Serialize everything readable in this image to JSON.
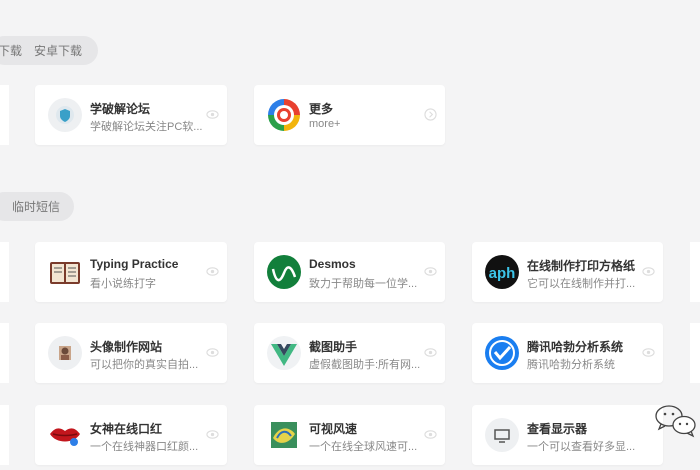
{
  "tabs_top": {
    "item1": "下载",
    "item2": "安卓下载"
  },
  "tabs_mid": {
    "item1": "临时短信"
  },
  "cards": [
    {
      "title": "学破解论坛",
      "desc": "学破解论坛关注PC软..."
    },
    {
      "title": "更多",
      "desc": "more+"
    },
    {
      "title": "Typing Practice",
      "desc": "看小说练打字"
    },
    {
      "title": "Desmos",
      "desc": "致力于帮助每一位学..."
    },
    {
      "title": "在线制作打印方格纸",
      "desc": "它可以在线制作并打..."
    },
    {
      "title": "头像制作网站",
      "desc": "可以把你的真实自拍..."
    },
    {
      "title": "截图助手",
      "desc": "虚假截图助手:所有网..."
    },
    {
      "title": "腾讯哈勃分析系统",
      "desc": "腾讯哈勃分析系统"
    },
    {
      "title": "女神在线口红",
      "desc": "一个在线神器口红颜..."
    },
    {
      "title": "可视风速",
      "desc": "一个在线全球风速可..."
    },
    {
      "title": "查看显示器",
      "desc": "一个可以查看好多显..."
    }
  ],
  "icons": {
    "xuepojie": "shield-icon",
    "more": "color-wheel-icon",
    "typing": "book-icon",
    "desmos": "graph-icon",
    "aph": "aph-logo",
    "avatar": "portrait-icon",
    "screenshot": "vue-logo",
    "habo": "check-shield-icon",
    "lipstick": "lips-icon",
    "wind": "globe-icon",
    "monitor": "monitor-icon"
  },
  "colors": {
    "desmos": "#127f3b",
    "habo": "#1a7ef0",
    "lipstick": "#c2161d"
  }
}
